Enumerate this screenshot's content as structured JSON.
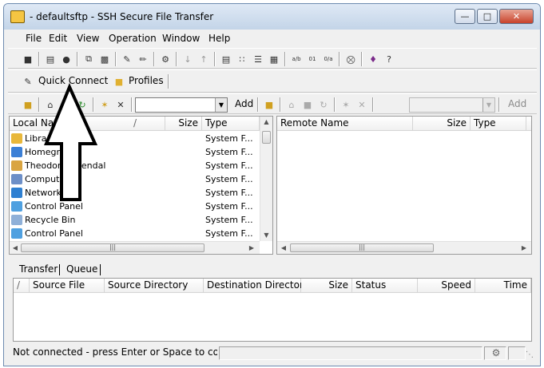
{
  "window": {
    "title": "- defaultsftp - SSH Secure File Transfer"
  },
  "menu": [
    "File",
    "Edit",
    "View",
    "Operation",
    "Window",
    "Help"
  ],
  "quick": {
    "quick_connect": "Quick Connect",
    "profiles": "Profiles"
  },
  "local": {
    "add_label": "Add",
    "path_value": "",
    "columns": [
      "Local Name",
      "Size",
      "Type"
    ],
    "rows": [
      {
        "name": "Libraries",
        "type": "System F...",
        "icon_color": "#e8b73a"
      },
      {
        "name": "Homegroup",
        "type": "System F...",
        "icon_color": "#3b7fd6"
      },
      {
        "name": "Theodoros Ivendal",
        "type": "System F...",
        "icon_color": "#d9a441"
      },
      {
        "name": "Computer",
        "type": "System F...",
        "icon_color": "#6d8fc7"
      },
      {
        "name": "Network",
        "type": "System F...",
        "icon_color": "#2e7fd1"
      },
      {
        "name": "Control Panel",
        "type": "System F...",
        "icon_color": "#4fa0e0"
      },
      {
        "name": "Recycle Bin",
        "type": "System F...",
        "icon_color": "#8fb0d8"
      },
      {
        "name": "Control Panel",
        "type": "System F...",
        "icon_color": "#4fa0e0"
      }
    ]
  },
  "remote": {
    "add_label": "Add",
    "path_value": "",
    "columns": [
      "Remote Name",
      "Size",
      "Type"
    ]
  },
  "transfer": {
    "tabs": [
      "Transfer",
      "Queue"
    ],
    "columns": [
      "Source File",
      "Source Directory",
      "Destination Directory",
      "Size",
      "Status",
      "Speed",
      "Time"
    ]
  },
  "status": {
    "text": "Not connected - press Enter or Space to connect"
  },
  "annotation": {
    "arrow_color": "#000000",
    "arrow_fill": "#ffffff"
  },
  "colors": {
    "accent": "#3b7fd6",
    "close_button": "#c8422b"
  }
}
